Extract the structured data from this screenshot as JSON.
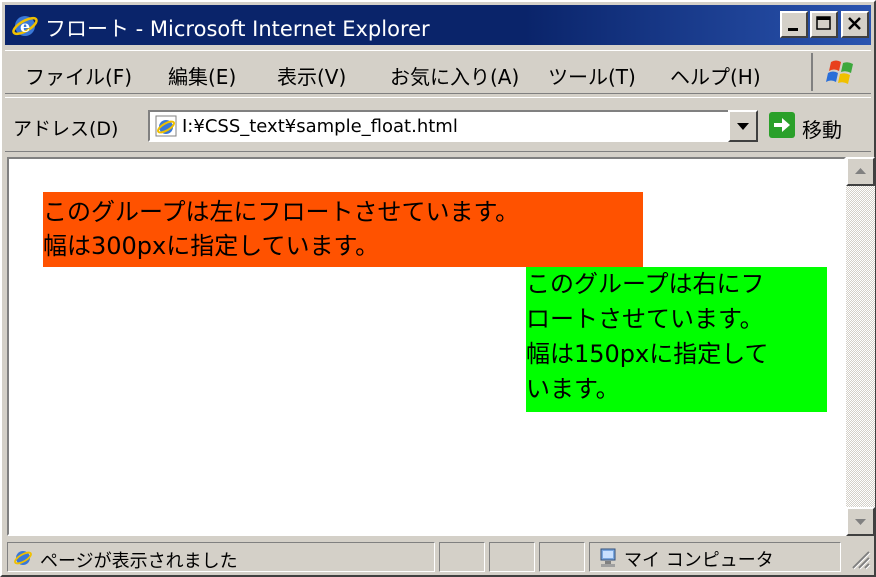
{
  "window": {
    "title": "フロート - Microsoft Internet Explorer"
  },
  "menu": {
    "items": [
      {
        "label": "ファイル(F)"
      },
      {
        "label": "編集(E)"
      },
      {
        "label": "表示(V)"
      },
      {
        "label": "お気に入り(A)"
      },
      {
        "label": "ツール(T)"
      },
      {
        "label": "ヘルプ(H)"
      }
    ]
  },
  "address": {
    "label": "アドレス(D)",
    "value": "I:¥CSS_text¥sample_float.html",
    "go_label": "移動"
  },
  "content": {
    "left_box": {
      "lines": [
        "このグループは左にフロートさせています。",
        "幅は300pxに指定しています。"
      ],
      "color": "#ff5200"
    },
    "right_box": {
      "lines": [
        "このグループは右にフ",
        "ロートさせています。",
        "幅は150pxに指定して",
        "います。"
      ],
      "color": "#00ff00"
    }
  },
  "status": {
    "text": "ページが表示されました",
    "zone": "マイ コンピュータ"
  },
  "colors": {
    "titlebar": "#0a246a",
    "chrome": "#d4d0c8"
  }
}
